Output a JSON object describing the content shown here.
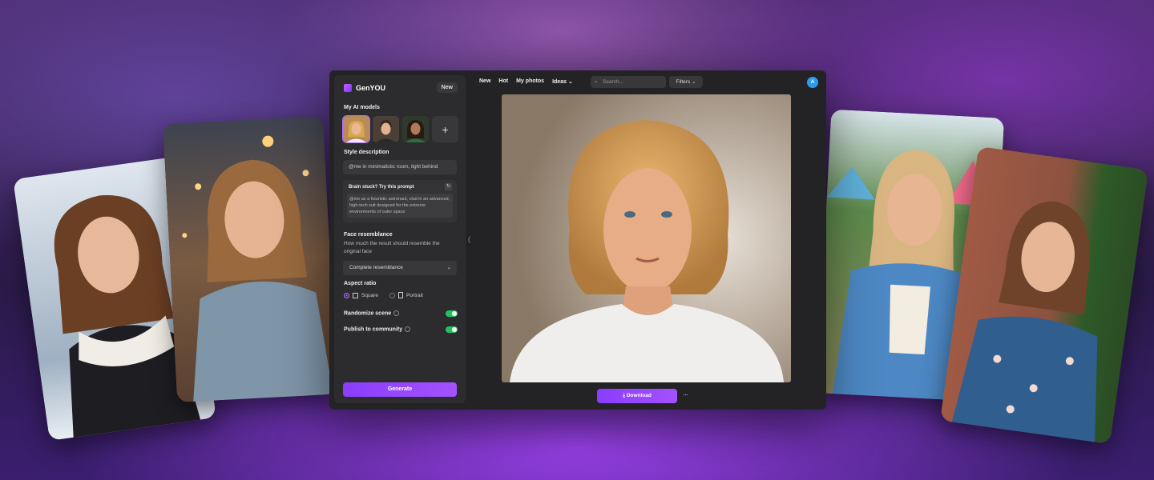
{
  "app": {
    "brand": "GenYOU",
    "new_label": "New"
  },
  "sidebar": {
    "models_title": "My AI models",
    "add_model_label": "+",
    "style_title": "Style description",
    "style_value": "@me in minimalistic room, light behind",
    "prompt_title": "Brain stuck? Try this prompt",
    "prompt_text": "@me as a futuristic astronaut, clad in an advanced, high-tech suit designed for the extreme environments of outer space",
    "face_title": "Face resemblance",
    "face_desc": "How much the result should resemble the original face",
    "face_value": "Complete resemblance",
    "aspect_title": "Aspect ratio",
    "aspect_options": [
      "Square",
      "Portrait"
    ],
    "aspect_selected": "Square",
    "randomize_label": "Randomize scene",
    "randomize_on": true,
    "publish_label": "Publish to community",
    "publish_on": true,
    "generate_label": "Generate"
  },
  "topnav": {
    "items": [
      "New",
      "Hot",
      "My photos",
      "Ideas"
    ],
    "search_placeholder": "Search...",
    "filters_label": "Filters",
    "avatar_initial": "A"
  },
  "main": {
    "download_label": "Download",
    "more_label": "···"
  },
  "colors": {
    "accent": "#9a47ff",
    "toggle_on": "#22c35e",
    "avatar": "#2d9cf0"
  }
}
